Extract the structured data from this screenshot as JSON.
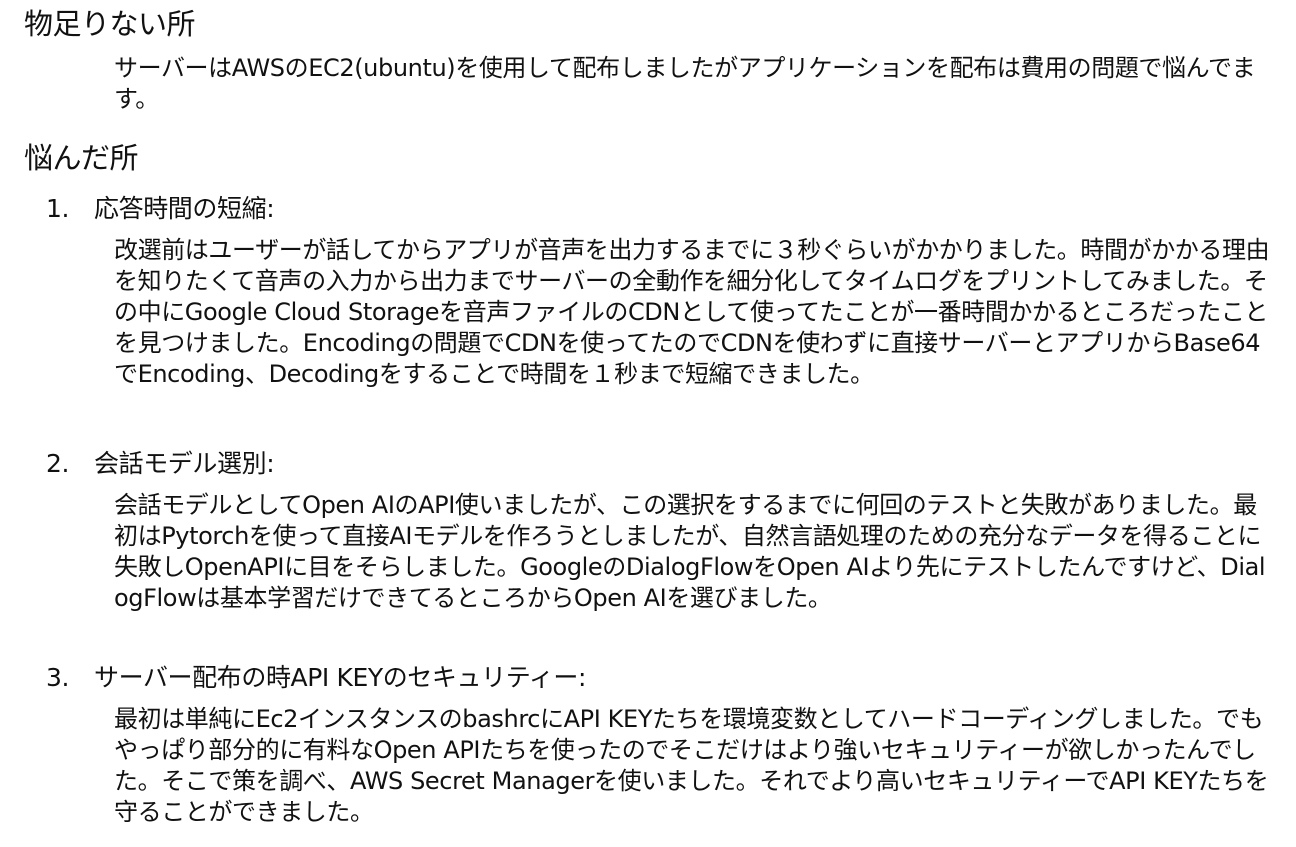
{
  "sections": [
    {
      "heading": "物足りない所",
      "paragraph": "サーバーはAWSのEC2(ubuntu)を使用して配布しましたがアプリケーションを配布は費用の問題で悩んでます。"
    },
    {
      "heading": "悩んだ所",
      "items": [
        {
          "number": "1.",
          "title": "応答時間の短縮:",
          "body": "改選前はユーザーが話してからアプリが音声を出力するまでに３秒ぐらいがかかりました。時間がかかる理由を知りたくて音声の入力から出力までサーバーの全動作を細分化してタイムログをプリントしてみました。その中にGoogle Cloud Storageを音声ファイルのCDNとして使ってたことが一番時間かかるところだったことを見つけました。Encodingの問題でCDNを使ってたのでCDNを使わずに直接サーバーとアプリからBase64でEncoding、Decodingをすることで時間を１秒まで短縮できました。"
        },
        {
          "number": "2.",
          "title": "会話モデル選別:",
          "body": "会話モデルとしてOpen AIのAPI使いましたが、この選択をするまでに何回のテストと失敗がありました。最初はPytorchを使って直接AIモデルを作ろうとしましたが、自然言語処理のための充分なデータを得ることに失敗しOpenAPIに目をそらしました。GoogleのDialogFlowをOpen AIより先にテストしたんですけど、DialogFlowは基本学習だけできてるところからOpen AIを選びました。"
        },
        {
          "number": "3.",
          "title": "サーバー配布の時API KEYのセキュリティー:",
          "body": "最初は単純にEc2インスタンスのbashrcにAPI KEYたちを環境変数としてハードコーディングしました。でもやっぱり部分的に有料なOpen APIたちを使ったのでそこだけはより強いセキュリティーが欲しかったんでした。そこで策を調べ、AWS Secret Managerを使いました。それでより高いセキュリティーでAPI KEYたちを守ることができました。"
        }
      ]
    }
  ]
}
